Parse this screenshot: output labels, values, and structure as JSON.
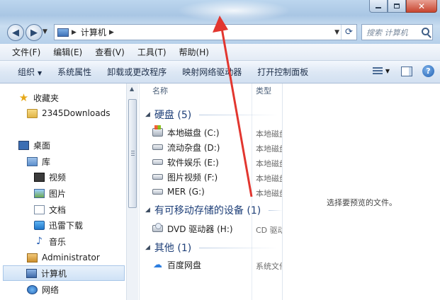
{
  "address": {
    "location": "计算机",
    "search_placeholder": "搜索 计算机"
  },
  "menubar": {
    "items": [
      "文件(F)",
      "编辑(E)",
      "查看(V)",
      "工具(T)",
      "帮助(H)"
    ]
  },
  "toolbar": {
    "organize": "组织",
    "items": [
      "系统属性",
      "卸载或更改程序",
      "映射网络驱动器",
      "打开控制面板"
    ]
  },
  "sidebar": {
    "items": [
      {
        "label": "收藏夹",
        "icon": "star-icon"
      },
      {
        "label": "2345Downloads",
        "icon": "folder-icon"
      },
      {
        "label": "桌面",
        "icon": "desktop-icon"
      },
      {
        "label": "库",
        "icon": "library-icon"
      },
      {
        "label": "视频",
        "icon": "video-icon"
      },
      {
        "label": "图片",
        "icon": "picture-icon"
      },
      {
        "label": "文档",
        "icon": "document-icon"
      },
      {
        "label": "迅雷下载",
        "icon": "thunder-icon"
      },
      {
        "label": "音乐",
        "icon": "music-icon"
      },
      {
        "label": "Administrator",
        "icon": "user-folder-icon"
      },
      {
        "label": "计算机",
        "icon": "computer-icon"
      },
      {
        "label": "网络",
        "icon": "network-icon"
      }
    ]
  },
  "columns": {
    "name": "名称",
    "type": "类型"
  },
  "groups": {
    "hdd": {
      "title": "硬盘 (5)",
      "items": [
        {
          "name": "本地磁盘 (C:)",
          "type": "本地磁盘"
        },
        {
          "name": "流动杂盘 (D:)",
          "type": "本地磁盘"
        },
        {
          "name": "软件娱乐 (E:)",
          "type": "本地磁盘"
        },
        {
          "name": "图片视频 (F:)",
          "type": "本地磁盘"
        },
        {
          "name": "MER (G:)",
          "type": "本地磁盘"
        }
      ]
    },
    "removable": {
      "title": "有可移动存储的设备 (1)",
      "items": [
        {
          "name": "DVD 驱动器 (H:)",
          "type": "CD 驱动器"
        }
      ]
    },
    "other": {
      "title": "其他 (1)",
      "items": [
        {
          "name": "百度网盘",
          "type": "系统文件夹"
        }
      ]
    }
  },
  "preview": {
    "text": "选择要预览的文件。"
  },
  "colors": {
    "annotation_arrow": "#e2362f",
    "group_title": "#1e3f78"
  }
}
